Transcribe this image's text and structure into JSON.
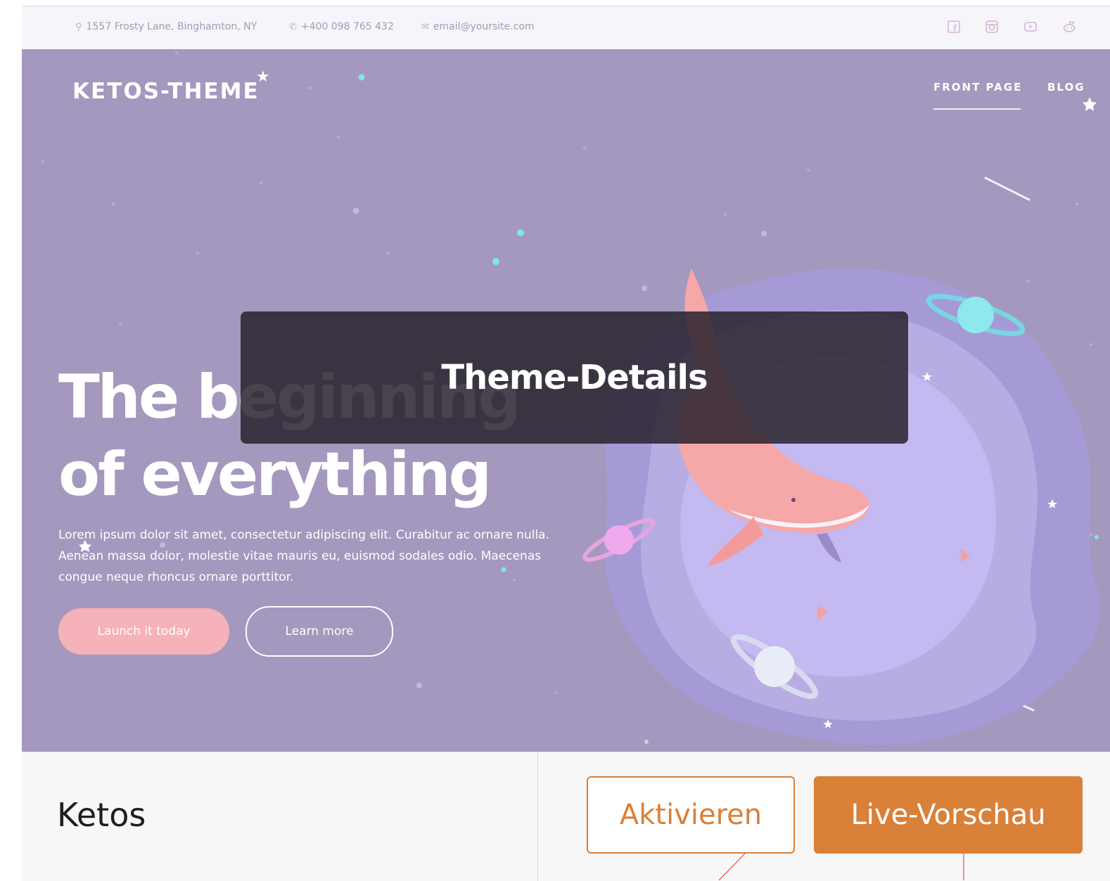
{
  "topbar": {
    "address": "1557 Frosty Lane, Binghamton, NY",
    "phone": "+400 098 765 432",
    "email": "email@yoursite.com",
    "social_icons": [
      "facebook-icon",
      "instagram-icon",
      "youtube-icon",
      "reddit-icon"
    ]
  },
  "header": {
    "logo": "KETOS-THEME",
    "nav": [
      "FRONT PAGE",
      "BLOG"
    ],
    "active_nav": "FRONT PAGE"
  },
  "hero": {
    "headline_line1": "The beginning",
    "headline_line2": "of everything",
    "text": "Lorem ipsum dolor sit amet, consectetur adipiscing elit. Curabitur ac ornare nulla. Aenean massa dolor, molestie vitae mauris eu, euismod sodales odio. Maecenas congue neque rhoncus ornare porttitor.",
    "primary_button": "Launch it today",
    "secondary_button": "Learn more"
  },
  "overlay": {
    "label": "Theme-Details"
  },
  "footer": {
    "theme_name": "Ketos",
    "activate_button": "Aktivieren",
    "preview_button": "Live-Vorschau"
  },
  "colors": {
    "hero_bg": "#a498be",
    "accent": "#d98039",
    "pink": "#f6b2ba",
    "overlay": "#28222d"
  }
}
